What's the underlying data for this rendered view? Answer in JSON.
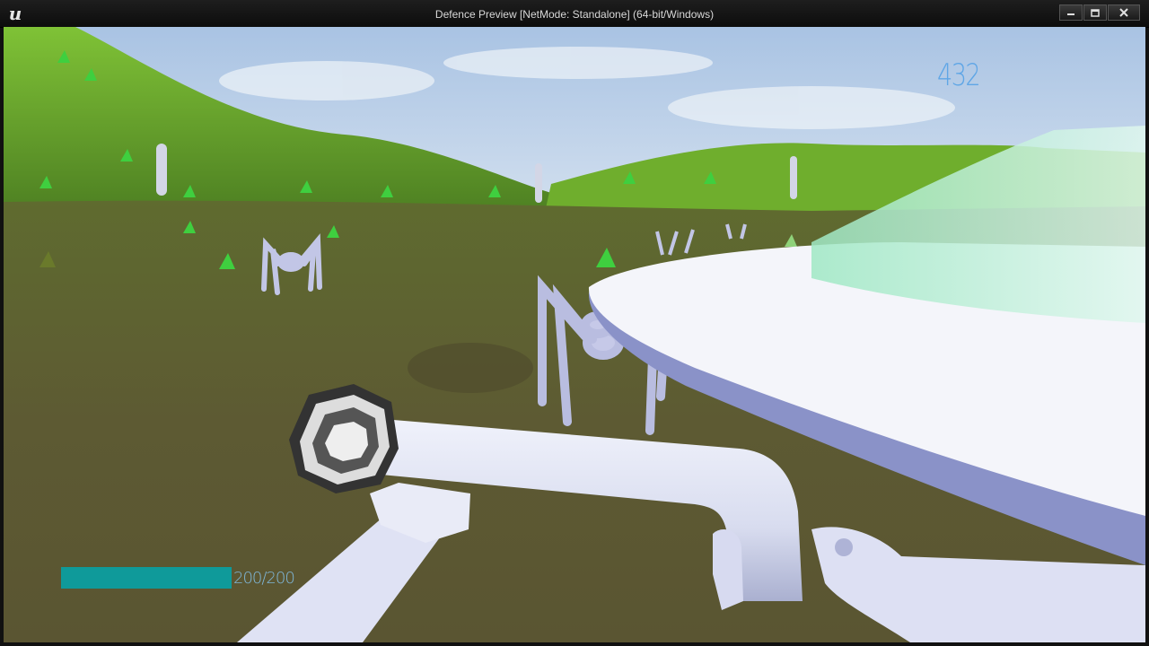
{
  "window": {
    "title": "Defence Preview [NetMode: Standalone]  (64-bit/Windows)",
    "logo_glyph": "u"
  },
  "hud": {
    "score": "432",
    "health_text": "200/200",
    "health_fraction": 1.0,
    "health_color": "#0f9a9a",
    "score_color": "#5fa6e6"
  },
  "icons": {
    "minimize": "minimize-icon",
    "maximize": "maximize-icon",
    "close": "close-icon"
  }
}
